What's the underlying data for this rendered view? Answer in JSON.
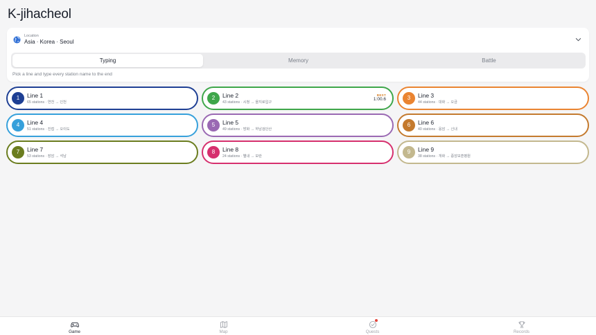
{
  "app": {
    "title": "K-jihacheol"
  },
  "location": {
    "label": "Location",
    "value": "Asia · Korea · Seoul",
    "icon": "globe-icon"
  },
  "modes": {
    "tabs": [
      {
        "label": "Typing",
        "active": true
      },
      {
        "label": "Memory",
        "active": false
      },
      {
        "label": "Battle",
        "active": false
      }
    ],
    "hint": "Pick a line and type every station name to the end"
  },
  "lines": [
    {
      "number": "1",
      "name": "Line 1",
      "meta": "65 stations · 연천 → 인천",
      "color": "#1e3f94",
      "best": null
    },
    {
      "number": "2",
      "name": "Line 2",
      "meta": "43 stations · 시청 → 을지로입구",
      "color": "#3ea64a",
      "best": {
        "label": "BEST",
        "time": "1:00.6"
      }
    },
    {
      "number": "3",
      "name": "Line 3",
      "meta": "44 stations · 대화 → 오금",
      "color": "#ea8431",
      "best": null
    },
    {
      "number": "4",
      "name": "Line 4",
      "meta": "51 stations · 진접 → 오이도",
      "color": "#36a0db",
      "best": null
    },
    {
      "number": "5",
      "name": "Line 5",
      "meta": "49 stations · 방화 → 하남검단산",
      "color": "#9a69b3",
      "best": null
    },
    {
      "number": "6",
      "name": "Line 6",
      "meta": "40 stations · 응암 → 신내",
      "color": "#c47a2e",
      "best": null
    },
    {
      "number": "7",
      "name": "Line 7",
      "meta": "53 stations · 장암 → 석남",
      "color": "#6b7d1f",
      "best": null
    },
    {
      "number": "8",
      "name": "Line 8",
      "meta": "24 stations · 별내 → 모란",
      "color": "#d6306e",
      "best": null
    },
    {
      "number": "9",
      "name": "Line 9",
      "meta": "38 stations · 개화 → 중앙보훈병원",
      "color": "#c3b88e",
      "best": null
    }
  ],
  "tabbar": {
    "items": [
      {
        "label": "Game",
        "icon": "gamepad-icon",
        "active": true
      },
      {
        "label": "Map",
        "icon": "map-icon",
        "active": false
      },
      {
        "label": "Quests",
        "icon": "quest-check-icon",
        "active": false,
        "notification": true
      },
      {
        "label": "Records",
        "icon": "trophy-icon",
        "active": false
      }
    ]
  }
}
